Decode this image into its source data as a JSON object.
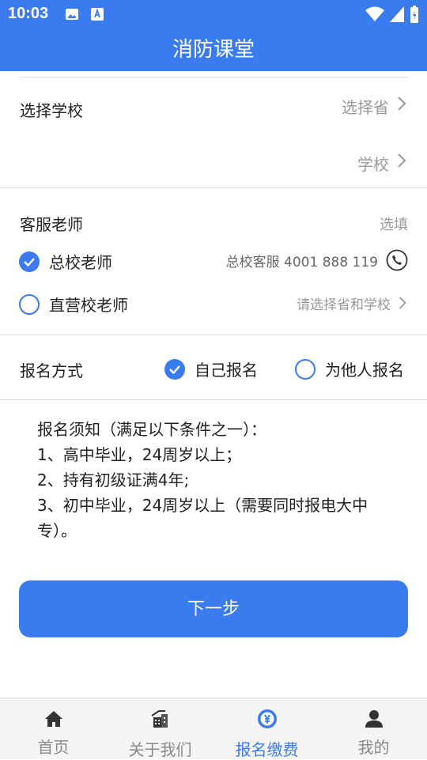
{
  "status_bar": {
    "time": "10:03"
  },
  "header": {
    "title": "消防课堂"
  },
  "school": {
    "label": "选择学校",
    "province_placeholder": "选择省",
    "school_placeholder": "学校"
  },
  "teacher": {
    "label": "客服老师",
    "hint": "选填",
    "options": [
      {
        "label": "总校老师",
        "detail": "总校客服 4001 888 119",
        "selected": true
      },
      {
        "label": "直营校老师",
        "detail": "请选择省和学校",
        "selected": false
      }
    ]
  },
  "signup": {
    "label": "报名方式",
    "options": [
      {
        "label": "自己报名",
        "selected": true
      },
      {
        "label": "为他人报名",
        "selected": false
      }
    ]
  },
  "notice": {
    "lines": [
      "报名须知（满足以下条件之一）：",
      "1、高中毕业，24周岁以上；",
      "2、持有初级证满4年;",
      "3、初中毕业，24周岁以上（需要同时报电大中专）。"
    ]
  },
  "next_button": {
    "label": "下一步"
  },
  "tabs": [
    {
      "label": "首页",
      "icon": "home-icon"
    },
    {
      "label": "关于我们",
      "icon": "building-icon"
    },
    {
      "label": "报名缴费",
      "icon": "payment-icon",
      "active": true
    },
    {
      "label": "我的",
      "icon": "user-icon"
    }
  ],
  "colors": {
    "accent": "#3a7bef"
  }
}
